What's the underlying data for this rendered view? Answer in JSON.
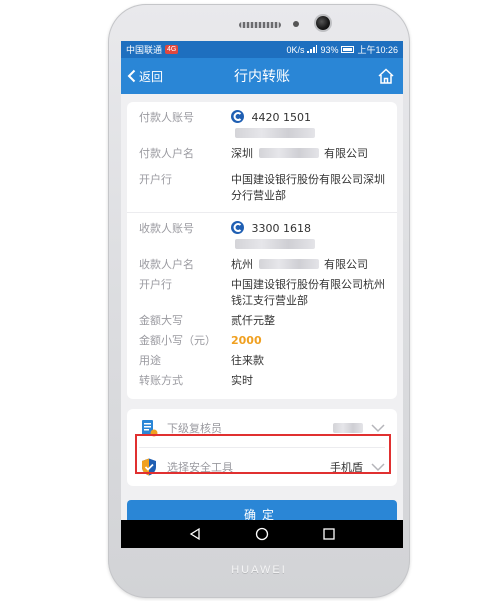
{
  "device": {
    "brand": "HUAWEI"
  },
  "statusbar": {
    "carrier": "中国联通",
    "carrier_badge": "4G",
    "speed": "0K/s",
    "signal_text": "93%",
    "time": "上午10:26"
  },
  "navbar": {
    "back_label": "返回",
    "title": "行内转账",
    "home_icon": "home-icon"
  },
  "payer": {
    "account_label": "付款人账号",
    "account_value": "4420 1501",
    "name_label": "付款人户名",
    "name_prefix": "深圳",
    "name_suffix": "有限公司",
    "bank_label": "开户行",
    "bank_value": "中国建设银行股份有限公司深圳分行营业部"
  },
  "payee": {
    "account_label": "收款人账号",
    "account_value": "3300 1618",
    "name_label": "收款人户名",
    "name_prefix": "杭州",
    "name_suffix": "有限公司",
    "bank_label": "开户行",
    "bank_value": "中国建设银行股份有限公司杭州钱江支行营业部"
  },
  "transfer": {
    "amount_words_label": "金额大写",
    "amount_words_value": "贰仟元整",
    "amount_label": "金额小写（元）",
    "amount_value": "2000",
    "purpose_label": "用途",
    "purpose_value": "往来款",
    "method_label": "转账方式",
    "method_value": "实时"
  },
  "reviewer": {
    "label": "下级复核员"
  },
  "security": {
    "label": "选择安全工具",
    "value": "手机盾"
  },
  "confirm_label": "确定",
  "colors": {
    "primary": "#2a86d6",
    "status": "#1e6fbf",
    "amount": "#f0a020",
    "highlight": "#e03030"
  }
}
